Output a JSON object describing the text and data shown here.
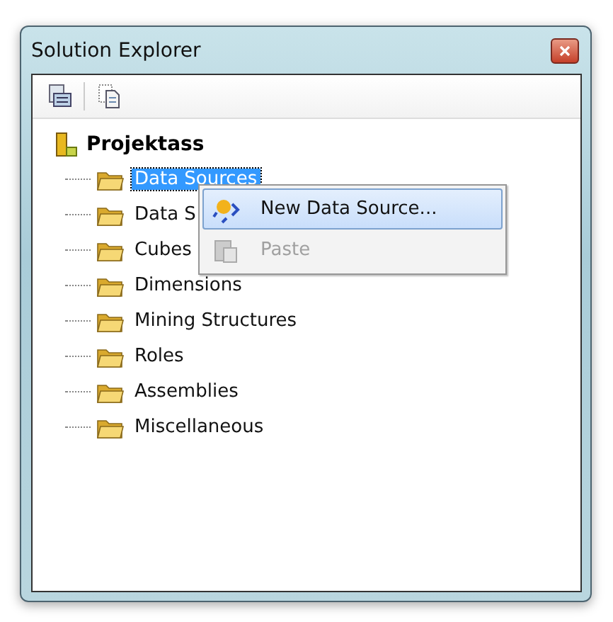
{
  "window": {
    "title": "Solution Explorer"
  },
  "tree": {
    "label": "Projektass",
    "children": [
      {
        "label": "Data Sources",
        "selected": true
      },
      {
        "label": "Data S",
        "selected": false
      },
      {
        "label": "Cubes",
        "selected": false
      },
      {
        "label": "Dimensions",
        "selected": false
      },
      {
        "label": "Mining Structures",
        "selected": false
      },
      {
        "label": "Roles",
        "selected": false
      },
      {
        "label": "Assemblies",
        "selected": false
      },
      {
        "label": "Miscellaneous",
        "selected": false
      }
    ]
  },
  "context_menu": {
    "items": [
      {
        "kind": "new",
        "label": "New Data Source...",
        "selected": true,
        "disabled": false
      },
      {
        "kind": "paste",
        "label": "Paste",
        "selected": false,
        "disabled": true
      }
    ]
  }
}
